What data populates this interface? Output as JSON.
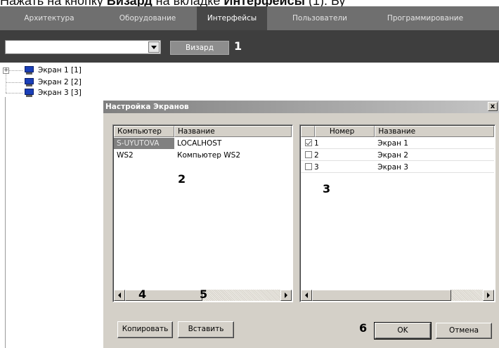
{
  "caption": {
    "prefix": "Нажать на кнопку ",
    "bold1": "Визард",
    "middle": " на вкладке ",
    "bold2": "Интерфейсы",
    "suffix": " (1). Бу"
  },
  "tabs": [
    {
      "label": "Архитектура",
      "active": false
    },
    {
      "label": "Оборудование",
      "active": false
    },
    {
      "label": "Интерфейсы",
      "active": true
    },
    {
      "label": "Пользователи",
      "active": false
    },
    {
      "label": "Программирование",
      "active": false
    }
  ],
  "toolbar": {
    "combo_value": "",
    "wizard_label": "Визард"
  },
  "tree": {
    "items": [
      {
        "label": "Экран 1 [1]",
        "icon": "monitor-icon"
      },
      {
        "label": "Экран 2 [2]",
        "icon": "monitor-icon"
      },
      {
        "label": "Экран 3 [3]",
        "icon": "monitor-icon"
      }
    ]
  },
  "dialog": {
    "title": "Настройка Экранов",
    "close_label": "x",
    "computers": {
      "headers": [
        "Компьютер",
        "Название"
      ],
      "rows": [
        {
          "computer": "S-UYUTOVA",
          "name": "LOCALHOST",
          "selected": true
        },
        {
          "computer": "WS2",
          "name": "Компьютер WS2",
          "selected": false
        }
      ]
    },
    "screens": {
      "headers": [
        "",
        "Номер",
        "Название"
      ],
      "rows": [
        {
          "number": "1",
          "name": "Экран 1",
          "checked": true
        },
        {
          "number": "2",
          "name": "Экран 2",
          "checked": false
        },
        {
          "number": "3",
          "name": "Экран 3",
          "checked": false
        }
      ]
    },
    "copy_label": "Копировать",
    "paste_label": "Вставить",
    "ok_label": "OK",
    "cancel_label": "Отмена"
  },
  "markers": {
    "m1": "1",
    "m2": "2",
    "m3": "3",
    "m4": "4",
    "m5": "5",
    "m6": "6"
  },
  "colors": {
    "tabbar": "#6f6f6f",
    "tab_active": "#474747",
    "toolbar": "#3e3e3e",
    "dialog_face": "#d4d0c8",
    "selection": "#808080"
  }
}
